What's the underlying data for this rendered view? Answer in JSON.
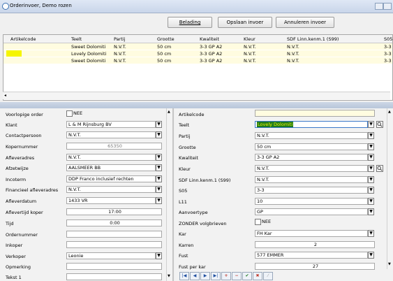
{
  "window": {
    "title": "Orderinvoer, Demo rozen"
  },
  "toolbar": {
    "belading": "Belading",
    "opslaan": "Opslaan invoer",
    "annuleren": "Annuleren invoer"
  },
  "grid": {
    "columns": [
      "Artikelcode",
      "Teelt",
      "Partij",
      "Grootte",
      "Kwaliteit",
      "Kleur",
      "SDF Linn.kenm.1 (S99)",
      "S05"
    ],
    "rows": [
      [
        "",
        "Sweet Dolomiti",
        "N.V.T.",
        "50 cm",
        "3-3 GP A2",
        "N.V.T.",
        "N.V.T.",
        "3-3"
      ],
      [
        "",
        "Lovely Dolomiti",
        "N.V.T.",
        "50 cm",
        "3-3 GP A2",
        "N.V.T.",
        "N.V.T.",
        "3-3"
      ],
      [
        "",
        "Sweet Dolomiti",
        "N.V.T.",
        "50 cm",
        "3-3 GP A2",
        "N.V.T.",
        "N.V.T.",
        "3-3"
      ]
    ]
  },
  "left": {
    "voorlopige_label": "Voorlopige order",
    "voorlopige_value": "NEE",
    "klant_label": "Klant",
    "klant_value": "L & M Rijnsburg BV",
    "contact_label": "Contactpersoon",
    "contact_value": "N.V.T.",
    "kopernummer_label": "Kopernummer",
    "kopernummer_value": "65350",
    "afleveradres_label": "Afleveradres",
    "afleveradres_value": "N.V.T.",
    "afzetwijze_label": "Afzetwijze",
    "afzetwijze_value": "AALSMEER BB",
    "incoterm_label": "Incoterm",
    "incoterm_value": "DDP Franco inclusief rechten",
    "financieel_label": "Financieel afleveradres",
    "financieel_value": "N.V.T.",
    "afleverdatum_label": "Afleverdatum",
    "afleverdatum_value": "1433 VR",
    "aflevertijd_label": "Aflevertijd koper",
    "aflevertijd_value": "17:00",
    "tijd_label": "Tijd",
    "tijd_value": "0:00",
    "ordernummer_label": "Ordernummer",
    "ordernummer_value": "",
    "inkoper_label": "Inkoper",
    "inkoper_value": "",
    "verkoper_label": "Verkoper",
    "verkoper_value": "Leonie",
    "opmerking_label": "Opmerking",
    "opmerking_value": "",
    "tekst1_label": "Tekst 1",
    "tekst1_value": ""
  },
  "right": {
    "artikelcode_label": "Artikelcode",
    "artikelcode_value": "",
    "teelt_label": "Teelt",
    "teelt_value": "Lovely Dolomiti",
    "partij_label": "Partij",
    "partij_value": "N.V.T.",
    "grootte_label": "Grootte",
    "grootte_value": "50 cm",
    "kwaliteit_label": "Kwaliteit",
    "kwaliteit_value": "3-3 GP A2",
    "kleur_label": "Kleur",
    "kleur_value": "N.V.T.",
    "sdf_label": "SDF Linn.kenm.1 (S99)",
    "sdf_value": "N.V.T.",
    "s05_label": "S05",
    "s05_value": "3-3",
    "l11_label": "L11",
    "l11_value": "10",
    "aanvoertype_label": "Aanvoertype",
    "aanvoertype_value": "GP",
    "zonder_label": "ZONDER volgbrieven",
    "zonder_value": "NEE",
    "kar_label": "Kar",
    "kar_value": "FH Kar",
    "karren_label": "Karren",
    "karren_value": "2",
    "fust_label": "Fust",
    "fust_value": "577 EMMER",
    "fustperkar_label": "Fust per kar",
    "fustperkar_value": "27"
  },
  "colors": {
    "accent": "#f5f500",
    "selection": "#1e7a1e"
  }
}
